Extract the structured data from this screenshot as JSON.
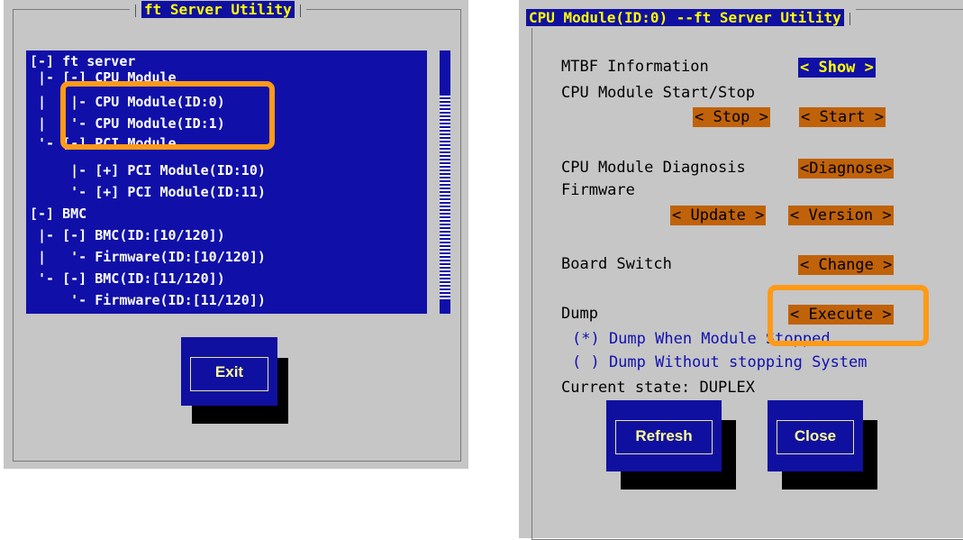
{
  "left": {
    "title": "ft Server Utility",
    "tree": [
      "[-] ft server",
      " |- [-] CPU Module",
      " |   |- CPU Module(ID:0)",
      " |   '- CPU Module(ID:1)",
      " '- [-] PCI Module",
      "     |- [+] PCI Module(ID:10)",
      "     '- [+] PCI Module(ID:11)",
      "[-] BMC",
      " |- [-] BMC(ID:[10/120])",
      " |   '- Firmware(ID:[10/120])",
      " '- [-] BMC(ID:[11/120])",
      "     '- Firmware(ID:[11/120])"
    ],
    "exit_label": "Exit"
  },
  "right": {
    "title": "CPU Module(ID:0) --ft Server Utility",
    "mtbf_label": "MTBF Information",
    "show_btn": "< Show >",
    "startstop_label": "CPU Module Start/Stop",
    "stop_btn": "< Stop >",
    "start_btn": "< Start >",
    "diag_label": "CPU Module Diagnosis",
    "diagnose_btn": "<Diagnose>",
    "firmware_label": "Firmware",
    "update_btn": "< Update >",
    "version_btn": "< Version >",
    "board_label": "Board Switch",
    "change_btn": "< Change >",
    "dump_label": "Dump",
    "execute_btn": "< Execute >",
    "radio1": "(*) Dump When Module Stopped",
    "radio2": "( ) Dump Without stopping System",
    "state": "Current state: DUPLEX",
    "refresh_label": "Refresh",
    "close_label": "Close"
  },
  "colors": {
    "highlight": "#ff9a18",
    "dialog_blue": "#1010a8",
    "action_orange": "#c0620a"
  }
}
